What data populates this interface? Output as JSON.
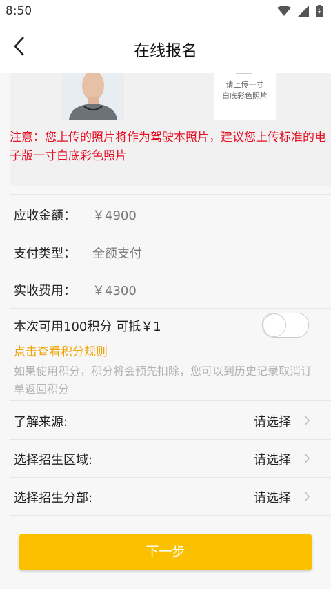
{
  "status": {
    "time": "8:50",
    "icons": [
      "wifi-icon",
      "signal-icon",
      "battery-icon"
    ]
  },
  "header": {
    "title": "在线报名",
    "back_icon": "chevron-left-icon"
  },
  "photos": {
    "upload_hint_line1": "请上传一寸",
    "upload_hint_line2": "白底彩色照片"
  },
  "notice": "注意：您上传的照片将作为驾驶本照片，建议您上传标准的电子版一寸白底彩色照片",
  "fees": {
    "receivable_label": "应收金额：",
    "receivable_value": "￥4900",
    "payment_type_label": "支付类型：",
    "payment_type_value": "全额支付",
    "actual_label": "实收费用：",
    "actual_value": "￥4300"
  },
  "points": {
    "label": "本次可用100积分   可抵￥1",
    "toggle_on": false,
    "rule_link": "点击查看积分规则",
    "note": "如果使用积分，积分将会预先扣除，您可以到历史记录取消订单返回积分"
  },
  "selects": [
    {
      "label": "了解来源:",
      "value": "请选择"
    },
    {
      "label": "选择招生区域:",
      "value": "请选择"
    },
    {
      "label": "选择招生分部:",
      "value": "请选择"
    }
  ],
  "next_button": "下一步",
  "colors": {
    "notice_red": "#e40f23",
    "link_orange": "#f0a300",
    "button_yellow": "#fbc100"
  }
}
